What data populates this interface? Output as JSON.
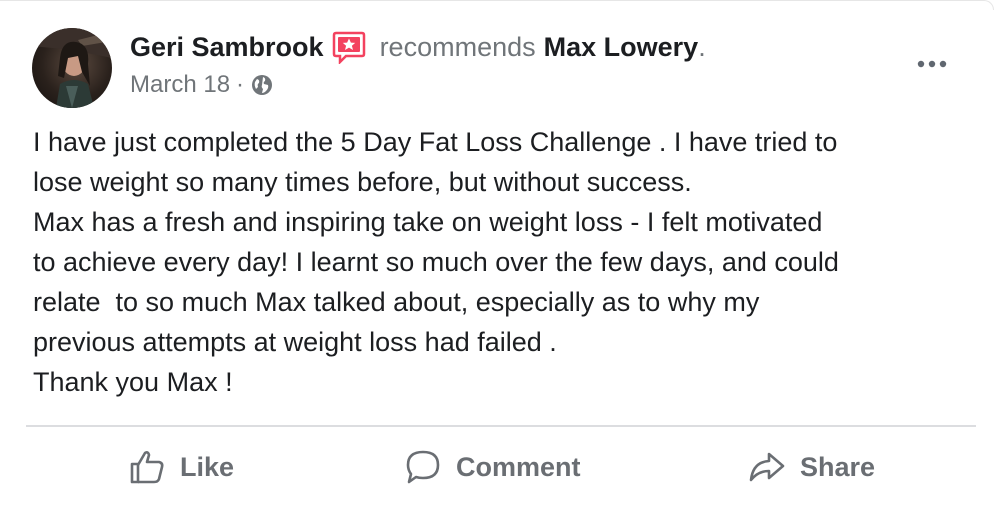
{
  "post": {
    "author_name": "Geri Sambrook",
    "recommends_text": "recommends",
    "page_name": "Max Lowery",
    "period": ".",
    "date": "March 18",
    "meta_separator": "·",
    "privacy_icon": "globe-icon",
    "more_icon": "more-horizontal-icon",
    "badge_icon": "recommend-star-icon",
    "badge_color": "#f3425f",
    "body": "I have just completed the 5 Day Fat Loss Challenge . I have tried to\nlose weight so many times before, but without success.\nMax has a fresh and inspiring take on weight loss - I felt motivated\nto achieve every day! I learnt so much over the few days, and could\nrelate  to so much Max talked about, especially as to why my\nprevious attempts at weight loss had failed .\nThank you Max !"
  },
  "actions": {
    "like_label": "Like",
    "like_icon": "thumbs-up-icon",
    "comment_label": "Comment",
    "comment_icon": "comment-bubble-icon",
    "share_label": "Share",
    "share_icon": "share-arrow-icon"
  },
  "colors": {
    "text_primary": "#1c1e21",
    "text_secondary": "#707579",
    "action_text": "#6a6e73",
    "divider": "#dcdde0"
  }
}
